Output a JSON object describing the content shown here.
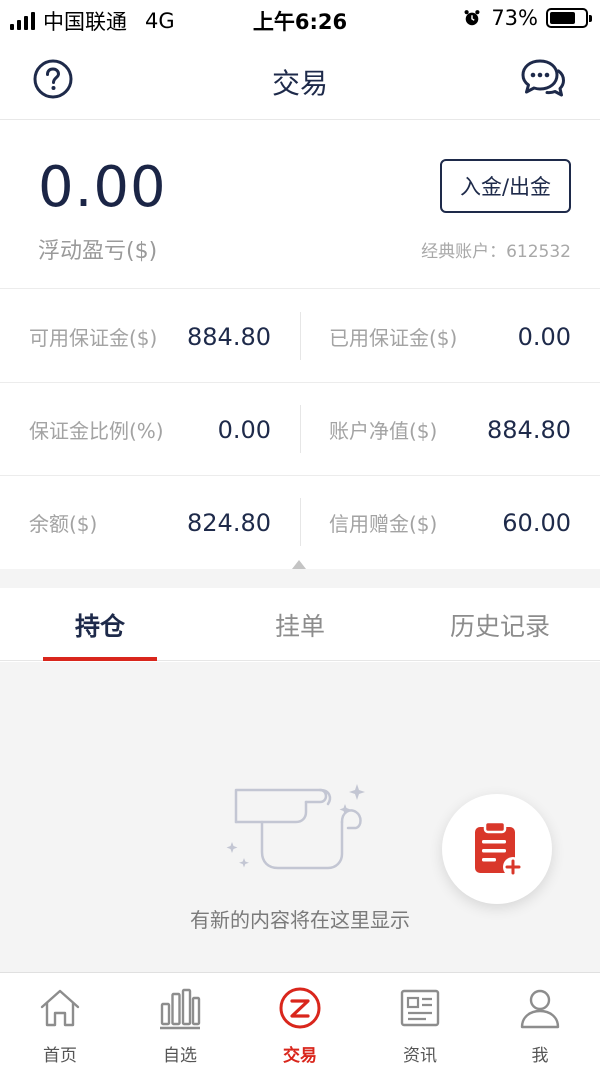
{
  "status_bar": {
    "carrier": "中国联通",
    "network": "4G",
    "time": "上午6:26",
    "battery": "73%",
    "battery_level": 0.73
  },
  "nav": {
    "title": "交易",
    "help_icon": "help-circle-icon",
    "chat_icon": "chat-bubbles-icon"
  },
  "account": {
    "floating_pl": "0.00",
    "floating_pl_label": "浮动盈亏($)",
    "deposit_withdraw_label": "入金/出金",
    "account_label": "经典账户：612532"
  },
  "stats": [
    {
      "left_label": "可用保证金($)",
      "left_value": "884.80",
      "right_label": "已用保证金($)",
      "right_value": "0.00"
    },
    {
      "left_label": "保证金比例(%)",
      "left_value": "0.00",
      "right_label": "账户净值($)",
      "right_value": "884.80"
    },
    {
      "left_label": "余额($)",
      "left_value": "824.80",
      "right_label": "信用赠金($)",
      "right_value": "60.00"
    }
  ],
  "tabs": [
    {
      "label": "持仓",
      "active": true
    },
    {
      "label": "挂单",
      "active": false
    },
    {
      "label": "历史记录",
      "active": false
    }
  ],
  "empty_state": {
    "icon": "empty-scroll-icon",
    "text": "有新的内容将在这里显示"
  },
  "fab": {
    "icon": "add-order-clipboard-icon"
  },
  "bottom_tabs": [
    {
      "label": "首页",
      "icon": "home-icon",
      "active": false
    },
    {
      "label": "自选",
      "icon": "bar-chart-icon",
      "active": false
    },
    {
      "label": "交易",
      "icon": "trade-logo-icon",
      "active": true
    },
    {
      "label": "资讯",
      "icon": "news-icon",
      "active": false
    },
    {
      "label": "我",
      "icon": "user-icon",
      "active": false
    }
  ],
  "colors": {
    "primary": "#1e2a4a",
    "accent": "#d9261c",
    "muted": "#a3a3a3",
    "background_gray": "#f4f4f4"
  }
}
